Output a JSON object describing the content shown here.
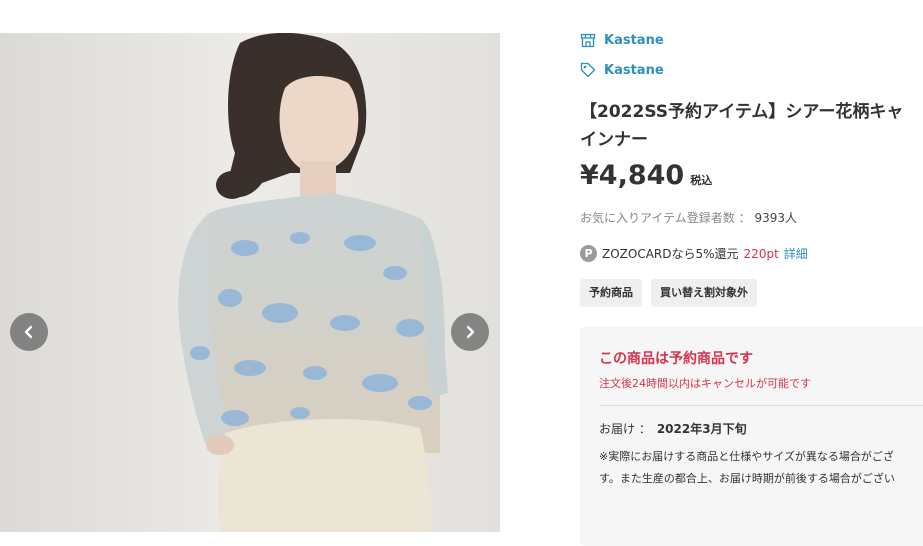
{
  "brand": {
    "shop_name": "Kastane",
    "brand_name": "Kastane"
  },
  "product": {
    "title_line1": "【2022SS予約アイテム】シアー花柄キャ",
    "title_line2": "インナー",
    "price": "¥4,840",
    "tax_label": "税込",
    "favorites_label": "お気に入りアイテム登録者数 ：",
    "favorites_count": "9393人"
  },
  "zozocard": {
    "badge": "P",
    "text": "ZOZOCARDなら5%還元",
    "points": "220pt",
    "detail_link": "詳細"
  },
  "tags": [
    "予約商品",
    "買い替え割対象外"
  ],
  "notice": {
    "heading": "この商品は予約商品です",
    "subtext": "注文後24時間以内はキャンセルが可能です",
    "delivery_label": "お届け ：",
    "delivery_value": "2022年3月下旬",
    "note_line1": "※実際にお届けする商品と仕様やサイズが異なる場合がござ",
    "note_line2": "す。また生産の都合上、お届け時期が前後する場合がござい"
  },
  "icons": {
    "shop": "shop-icon",
    "brand_tag": "tag-icon",
    "prev": "chevron-left-icon",
    "next": "chevron-right-icon"
  },
  "colors": {
    "link_blue": "#2d8fbe",
    "accent_red": "#d6344d",
    "panel_bg": "#f6f6f6",
    "tag_bg": "#efefef"
  }
}
